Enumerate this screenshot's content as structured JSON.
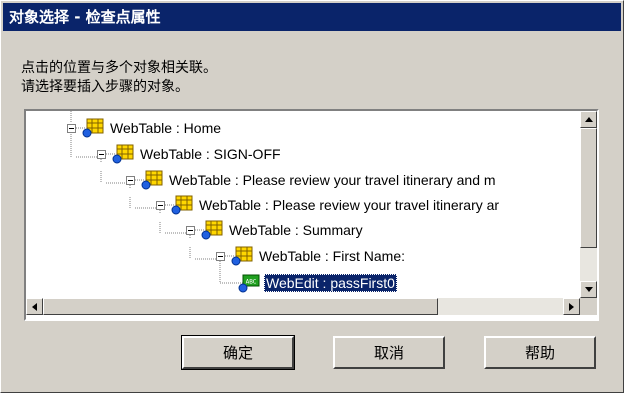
{
  "dialog": {
    "title": "对象选择 - 检查点属性",
    "message_line1": "点击的位置与多个对象相关联。",
    "message_line2": "请选择要插入步骤的对象。"
  },
  "tree": {
    "nodes": [
      {
        "label": "WebTable : Home",
        "icon": "webtable-icon",
        "expanded": true
      },
      {
        "label": "WebTable : SIGN-OFF",
        "icon": "webtable-icon",
        "expanded": true
      },
      {
        "label": "WebTable : Please review your travel itinerary and m",
        "icon": "webtable-icon",
        "expanded": true
      },
      {
        "label": "WebTable : Please review your travel itinerary ar",
        "icon": "webtable-icon",
        "expanded": true
      },
      {
        "label": "WebTable : Summary",
        "icon": "webtable-icon",
        "expanded": true
      },
      {
        "label": "WebTable : First Name:",
        "icon": "webtable-icon",
        "expanded": true
      },
      {
        "label": "WebEdit : passFirst0",
        "icon": "webedit-icon",
        "selected": true
      }
    ]
  },
  "buttons": {
    "ok": "确定",
    "cancel": "取消",
    "help": "帮助"
  },
  "colors": {
    "titlebar": "#0a246a",
    "selection": "#0a246a",
    "face": "#d4d0c8"
  }
}
